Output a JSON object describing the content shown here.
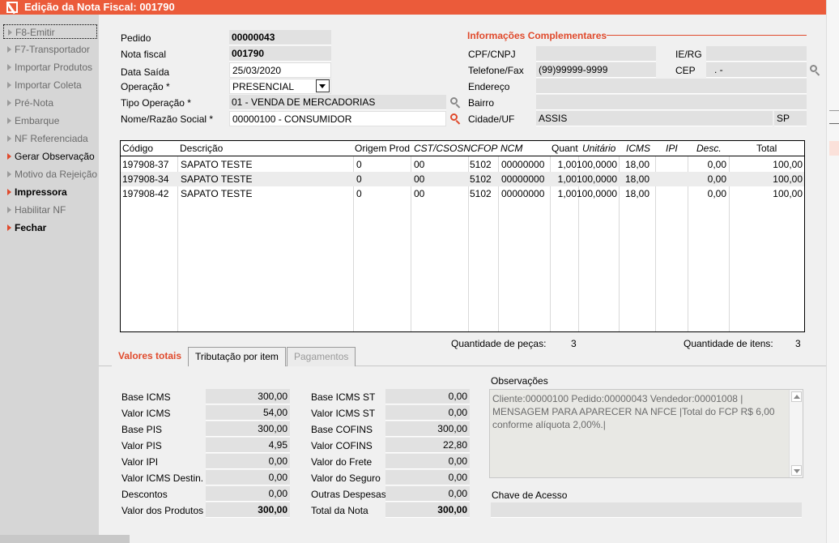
{
  "window": {
    "title": "Edição da Nota Fiscal: 001790"
  },
  "sidebar": {
    "items": [
      {
        "label": "F8-Emitir"
      },
      {
        "label": "F7-Transportador"
      },
      {
        "label": "Importar Produtos"
      },
      {
        "label": "Importar Coleta"
      },
      {
        "label": "Pré-Nota"
      },
      {
        "label": "Embarque"
      },
      {
        "label": "NF Referenciada"
      },
      {
        "label": "Gerar Observação"
      },
      {
        "label": "Motivo da Rejeição"
      },
      {
        "label": "Impressora"
      },
      {
        "label": "Habilitar NF"
      },
      {
        "label": "Fechar"
      }
    ]
  },
  "form": {
    "pedido_label": "Pedido",
    "pedido_value": "00000043",
    "nota_label": "Nota fiscal",
    "nota_value": "001790",
    "data_label": "Data Saída",
    "data_value": "25/03/2020",
    "operacao_label": "Operação *",
    "operacao_value": "PRESENCIAL",
    "tipo_label": "Tipo Operação *",
    "tipo_value": "01 - VENDA DE MERCADORIAS",
    "nome_label": "Nome/Razão Social *",
    "nome_value": "00000100 - CONSUMIDOR"
  },
  "info": {
    "title": "Informações Complementares",
    "cpf_label": "CPF/CNPJ",
    "cpf_value": "",
    "ie_label": "IE/RG",
    "ie_value": "",
    "tel_label": "Telefone/Fax",
    "tel_value": "(99)99999-9999",
    "cep_label": "CEP",
    "cep_value": ".   -",
    "endereco_label": "Endereço",
    "endereco_value": "",
    "bairro_label": "Bairro",
    "bairro_value": "",
    "cidade_label": "Cidade/UF",
    "cidade_value": "ASSIS",
    "uf_value": "SP"
  },
  "grid": {
    "headers": [
      "Código",
      "Descrição",
      "Origem Prod",
      "CST/CSOSN",
      "CFOP",
      "NCM",
      "Quant",
      "Unitário",
      "ICMS",
      "IPI",
      "Desc.",
      "Total"
    ],
    "rows": [
      [
        "197908-37",
        "SAPATO TESTE",
        "0",
        "00",
        "5102",
        "00000000",
        "1,00",
        "100,0000",
        "18,00",
        "",
        "0,00",
        "100,00"
      ],
      [
        "197908-34",
        "SAPATO TESTE",
        "0",
        "00",
        "5102",
        "00000000",
        "1,00",
        "100,0000",
        "18,00",
        "",
        "0,00",
        "100,00"
      ],
      [
        "197908-42",
        "SAPATO TESTE",
        "0",
        "00",
        "5102",
        "00000000",
        "1,00",
        "100,0000",
        "18,00",
        "",
        "0,00",
        "100,00"
      ]
    ]
  },
  "summary": {
    "pecas_label": "Quantidade de peças:",
    "pecas_value": "3",
    "itens_label": "Quantidade de itens:",
    "itens_value": "3"
  },
  "tabs": [
    {
      "label": "Valores totais"
    },
    {
      "label": "Tributação por item"
    },
    {
      "label": "Pagamentos"
    }
  ],
  "totals": {
    "left": [
      {
        "label": "Base ICMS",
        "value": "300,00"
      },
      {
        "label": "Valor ICMS",
        "value": "54,00"
      },
      {
        "label": "Base PIS",
        "value": "300,00"
      },
      {
        "label": "Valor PIS",
        "value": "4,95"
      },
      {
        "label": "Valor IPI",
        "value": "0,00"
      },
      {
        "label": "Valor ICMS Destin.",
        "value": "0,00"
      },
      {
        "label": "Descontos",
        "value": "0,00"
      },
      {
        "label": "Valor dos Produtos",
        "value": "300,00"
      }
    ],
    "right": [
      {
        "label": "Base ICMS ST",
        "value": "0,00"
      },
      {
        "label": "Valor ICMS ST",
        "value": "0,00"
      },
      {
        "label": "Base COFINS",
        "value": "300,00"
      },
      {
        "label": "Valor COFINS",
        "value": "22,80"
      },
      {
        "label": "Valor do Frete",
        "value": "0,00"
      },
      {
        "label": "Valor do Seguro",
        "value": "0,00"
      },
      {
        "label": "Outras Despesas",
        "value": "0,00"
      },
      {
        "label": "Total da Nota",
        "value": "300,00"
      }
    ]
  },
  "obs": {
    "label": "Observações",
    "text": "Cliente:00000100  Pedido:00000043  Vendedor:00001008 | MENSAGEM PARA APARECER NA NFCE |Total do FCP R$ 6,00 conforme alíquota 2,00%.|"
  },
  "chave": {
    "label": "Chave de Acesso",
    "value": ""
  },
  "colors": {
    "accent": "#eb5b3a",
    "link_red": "#e04a2c"
  }
}
